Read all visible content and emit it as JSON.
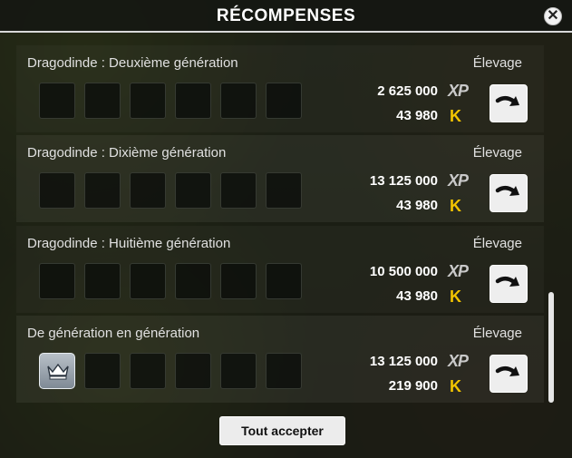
{
  "window": {
    "title": "RÉCOMPENSES",
    "close_symbol": "✕"
  },
  "rewards": [
    {
      "title": "Dragodinde : Deuxième génération",
      "category": "Élevage",
      "xp": "2 625 000",
      "xp_label": "XP",
      "kamas": "43 980",
      "kama_symbol": "K",
      "slots": [
        "empty",
        "empty",
        "empty",
        "empty",
        "empty",
        "empty"
      ]
    },
    {
      "title": "Dragodinde : Dixième génération",
      "category": "Élevage",
      "xp": "13 125 000",
      "xp_label": "XP",
      "kamas": "43 980",
      "kama_symbol": "K",
      "slots": [
        "empty",
        "empty",
        "empty",
        "empty",
        "empty",
        "empty"
      ]
    },
    {
      "title": "Dragodinde : Huitième génération",
      "category": "Élevage",
      "xp": "10 500 000",
      "xp_label": "XP",
      "kamas": "43 980",
      "kama_symbol": "K",
      "slots": [
        "empty",
        "empty",
        "empty",
        "empty",
        "empty",
        "empty"
      ]
    },
    {
      "title": "De génération en génération",
      "category": "Élevage",
      "xp": "13 125 000",
      "xp_label": "XP",
      "kamas": "219 900",
      "kama_symbol": "K",
      "slots": [
        "crown-icon",
        "empty",
        "empty",
        "empty",
        "empty",
        "empty"
      ]
    }
  ],
  "footer": {
    "accept_all_label": "Tout accepter"
  },
  "colors": {
    "kama": "#f2c400",
    "xp": "#c9c9c9",
    "panel": "#121410"
  }
}
